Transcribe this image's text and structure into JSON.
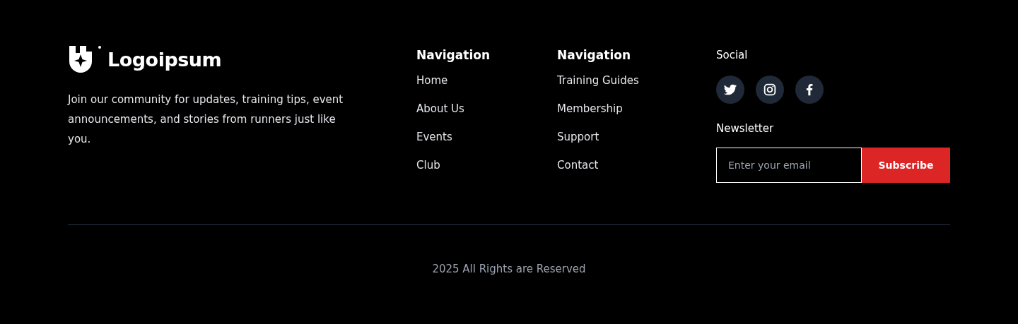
{
  "brand": {
    "name": "Logoipsum",
    "tagline": "Join our community for updates, training tips, event announcements, and stories from runners just like you."
  },
  "nav_columns": [
    {
      "title": "Navigation",
      "links": [
        "Home",
        "About Us",
        "Events",
        "Club"
      ]
    },
    {
      "title": "Navigation",
      "links": [
        "Training Guides",
        "Membership",
        "Support",
        "Contact"
      ]
    }
  ],
  "social": {
    "title": "Social",
    "links": [
      {
        "kind": "twitter"
      },
      {
        "kind": "instagram"
      },
      {
        "kind": "facebook"
      }
    ]
  },
  "newsletter": {
    "title": "Newsletter",
    "placeholder": "Enter your email",
    "button": "Subscribe"
  },
  "copyright": "2025 All Rights are Reserved"
}
